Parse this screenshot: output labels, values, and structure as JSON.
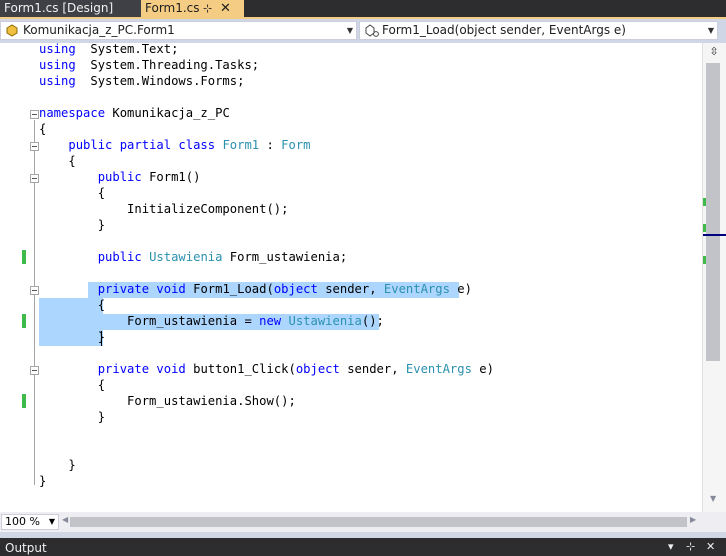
{
  "tabs": [
    {
      "label": "Form1.cs [Design]",
      "active": false
    },
    {
      "label": "Form1.cs",
      "active": true,
      "pin": "⊹",
      "close": "✕"
    }
  ],
  "nav": {
    "class_combo": "Komunikacja_z_PC.Form1",
    "member_combo": "Form1_Load(object sender, EventArgs e)"
  },
  "code_lines": [
    {
      "parts": [
        [
          "kw",
          "using"
        ],
        [
          "",
          "  System.Text;"
        ]
      ]
    },
    {
      "parts": [
        [
          "kw",
          "using"
        ],
        [
          "",
          "  System.Threading.Tasks;"
        ]
      ]
    },
    {
      "parts": [
        [
          "kw",
          "using"
        ],
        [
          "",
          "  System.Windows.Forms;"
        ]
      ]
    },
    {
      "parts": []
    },
    {
      "parts": [
        [
          "kw",
          "namespace"
        ],
        [
          "",
          " Komunikacja_z_PC"
        ]
      ]
    },
    {
      "parts": [
        [
          "",
          "{"
        ]
      ]
    },
    {
      "parts": [
        [
          "",
          "    "
        ],
        [
          "kw",
          "public partial class"
        ],
        [
          "",
          " "
        ],
        [
          "ty",
          "Form1"
        ],
        [
          "",
          " : "
        ],
        [
          "ty",
          "Form"
        ]
      ]
    },
    {
      "parts": [
        [
          "",
          "    {"
        ]
      ]
    },
    {
      "parts": [
        [
          "",
          "        "
        ],
        [
          "kw",
          "public"
        ],
        [
          "",
          " Form1()"
        ]
      ]
    },
    {
      "parts": [
        [
          "",
          "        {"
        ]
      ]
    },
    {
      "parts": [
        [
          "",
          "            InitializeComponent();"
        ]
      ]
    },
    {
      "parts": [
        [
          "",
          "        }"
        ]
      ]
    },
    {
      "parts": []
    },
    {
      "parts": [
        [
          "",
          "        "
        ],
        [
          "kw",
          "public"
        ],
        [
          "",
          " "
        ],
        [
          "ty",
          "Ustawienia"
        ],
        [
          "",
          " Form_ustawienia;"
        ]
      ]
    },
    {
      "parts": []
    },
    {
      "parts": [
        [
          "",
          "        "
        ],
        [
          "kw",
          "private void"
        ],
        [
          "",
          " Form1_Load("
        ],
        [
          "kw",
          "object"
        ],
        [
          "",
          " sender, "
        ],
        [
          "ty",
          "EventArgs"
        ],
        [
          "",
          " e)"
        ]
      ]
    },
    {
      "parts": [
        [
          "",
          "        {"
        ]
      ]
    },
    {
      "parts": [
        [
          "",
          "            Form_ustawienia = "
        ],
        [
          "kw",
          "new"
        ],
        [
          "",
          " "
        ],
        [
          "ty",
          "Ustawienia"
        ],
        [
          "",
          "();"
        ]
      ]
    },
    {
      "parts": [
        [
          "",
          "        }"
        ]
      ]
    },
    {
      "parts": []
    },
    {
      "parts": [
        [
          "",
          "        "
        ],
        [
          "kw",
          "private void"
        ],
        [
          "",
          " button1_Click("
        ],
        [
          "kw",
          "object"
        ],
        [
          "",
          " sender, "
        ],
        [
          "ty",
          "EventArgs"
        ],
        [
          "",
          " e)"
        ]
      ]
    },
    {
      "parts": [
        [
          "",
          "        {"
        ]
      ]
    },
    {
      "parts": [
        [
          "",
          "            Form_ustawienia.Show();"
        ]
      ]
    },
    {
      "parts": [
        [
          "",
          "        }"
        ]
      ]
    },
    {
      "parts": []
    },
    {
      "parts": []
    },
    {
      "parts": [
        [
          "",
          "    }"
        ]
      ]
    },
    {
      "parts": [
        [
          "",
          "}"
        ]
      ]
    }
  ],
  "zoom": "100 %",
  "output": {
    "title": "Output",
    "dropdown": "▾",
    "pin": "⊹",
    "close": "✕"
  }
}
